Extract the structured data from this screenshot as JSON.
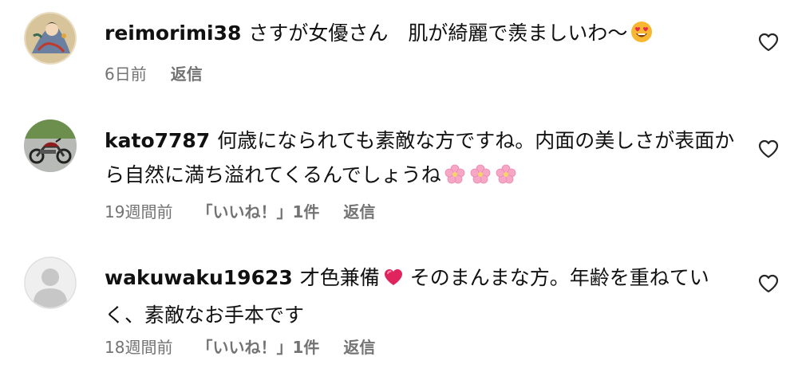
{
  "comments": [
    {
      "username": "reimorimi38",
      "text": "さすが女優さん　肌が綺麗で羨ましいわ〜",
      "emoji": [
        "heart-eyes-emoji"
      ],
      "time": "6日前",
      "likes": "",
      "reply": "返信",
      "avatar": "illustrated-figure-avatar"
    },
    {
      "username": "kato7787",
      "text": "何歳になられても素敵な方ですね。内面の美しさが表面から自然に満ち溢れてくるんでしょうね",
      "emoji": [
        "cherry-blossom-emoji",
        "cherry-blossom-emoji",
        "cherry-blossom-emoji"
      ],
      "time": "19週間前",
      "likes": "「いいね！」1件",
      "reply": "返信",
      "avatar": "motorcycle-avatar"
    },
    {
      "username": "wakuwaku19623",
      "text_before": "才色兼備",
      "text_after": " そのまんまな方。年齢を重ねていく、素敵なお手本です",
      "emoji": [
        "beating-heart-emoji"
      ],
      "time": "18週間前",
      "likes": "「いいね！」1件",
      "reply": "返信",
      "avatar": "default-user-avatar"
    }
  ],
  "colors": {
    "meta": "#737373",
    "text": "#111111",
    "heart_outline": "#262626"
  }
}
